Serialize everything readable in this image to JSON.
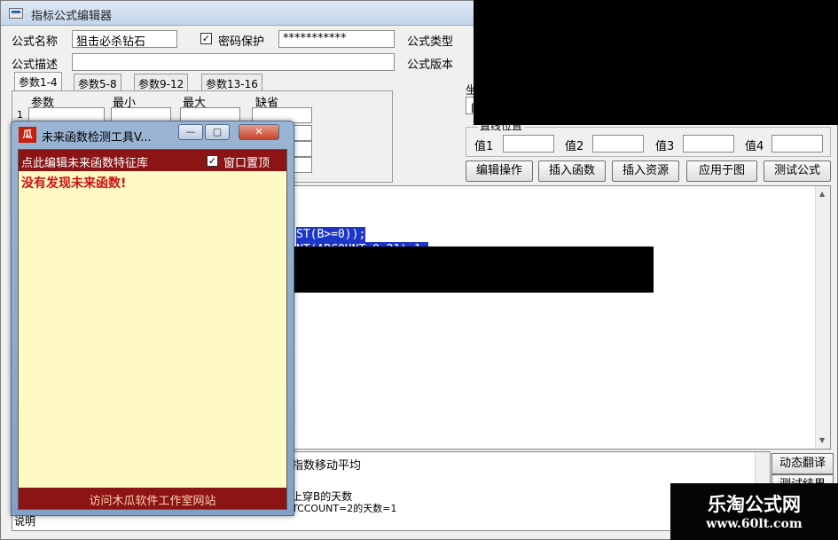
{
  "main": {
    "title": "指标公式编辑器",
    "formula_name_label": "公式名称",
    "formula_name_value": "狙击必杀钻石",
    "password_label": "密码保护",
    "password_checked": "✓",
    "password_value": "***********",
    "formula_type_label": "公式类型",
    "formula_desc_label": "公式描述",
    "formula_desc_value": "",
    "formula_version_label": "公式版本",
    "tabs": [
      {
        "label": "参数1-4"
      },
      {
        "label": "参数5-8"
      },
      {
        "label": "参数9-12"
      },
      {
        "label": "参数13-16"
      }
    ],
    "param_headers": [
      "参数",
      "最小",
      "最大",
      "缺省"
    ],
    "param_row_label": "1",
    "axis_fragment": "坐",
    "axis_value_fragment": "自",
    "axis_group_fragment": "直线位置",
    "value_labels": [
      "值1",
      "值2",
      "值3",
      "值4"
    ],
    "buttons": {
      "edit_ops": "编辑操作",
      "insert_func": "插入函数",
      "insert_resource": "插入资源",
      "apply_chart": "应用于图",
      "test_formula": "测试公式"
    },
    "code_lines": [
      "ST(B>=0));",
      "NT(ABCOUNT,0,21)-1;"
    ],
    "desc_lines": [
      "指数移动平均",
      "上穿B的天数",
      "TCCOUNT=2的天数=1"
    ],
    "desc_bottom_fragment": "说明",
    "side_buttons": {
      "dynamic_translate": "动态翻译",
      "test_result": "测试结果"
    }
  },
  "tool": {
    "icon_text": "瓜",
    "title": "未来函数检测工具V...",
    "minimize": "—",
    "maximize": "▢",
    "close": "✕",
    "edit_link": "点此编辑未来函数特征库",
    "topmost_checked": "✓",
    "topmost_label": "窗口置顶",
    "result": "没有发现未来函数!",
    "visit_link": "访问木瓜软件工作室网站"
  },
  "watermark": {
    "title": "乐淘公式网",
    "url": "www.60lt.com"
  }
}
